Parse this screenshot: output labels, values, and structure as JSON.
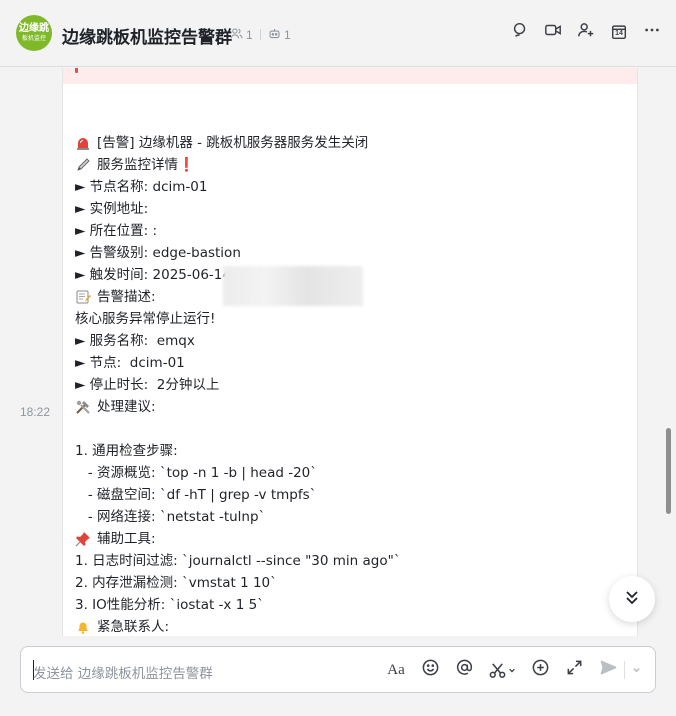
{
  "header": {
    "avatar_line1": "边缘跳",
    "avatar_line2": "板机监控",
    "title": "边缘跳板机监控告警群",
    "members_count": "1",
    "bots_count": "1",
    "icons": [
      "search-icon",
      "video-icon",
      "add-member-icon",
      "calendar-icon",
      "more-icon"
    ],
    "calendar_day": "14"
  },
  "message": {
    "time": "18:22",
    "lines": [
      {
        "emoji": "siren",
        "text": "[告警] 边缘机器 - 跳板机服务器服务发生关闭"
      },
      {
        "emoji": "pencil",
        "text": "服务监控详情❗"
      },
      {
        "emoji": null,
        "text": "► 节点名称: dcim-01"
      },
      {
        "emoji": null,
        "text": "► 实例地址: "
      },
      {
        "emoji": null,
        "text": "► 所在位置: :"
      },
      {
        "emoji": null,
        "text": "► 告警级别: edge-bastion"
      },
      {
        "emoji": null,
        "text": "► 触发时间: 2025-06-14 18:22:12"
      },
      {
        "emoji": "memo",
        "text": "告警描述:"
      },
      {
        "emoji": null,
        "text": "核心服务异常停止运行!"
      },
      {
        "emoji": null,
        "text": "► 服务名称:  emqx"
      },
      {
        "emoji": null,
        "text": "► 节点:  dcim-01"
      },
      {
        "emoji": null,
        "text": "► 停止时长:  2分钟以上"
      },
      {
        "emoji": "tools",
        "text": "处理建议:"
      },
      {
        "emoji": null,
        "text": ""
      },
      {
        "emoji": null,
        "text": "1. 通用检查步骤:"
      },
      {
        "emoji": null,
        "text": "   - 资源概览: `top -n 1 -b | head -20`"
      },
      {
        "emoji": null,
        "text": "   - 磁盘空间: `df -hT | grep -v tmpfs`"
      },
      {
        "emoji": null,
        "text": "   - 网络连接: `netstat -tulnp`"
      },
      {
        "emoji": "pushpin",
        "text": "辅助工具:"
      },
      {
        "emoji": null,
        "text": "1. 日志时间过滤: `journalctl --since \"30 min ago\"`"
      },
      {
        "emoji": null,
        "text": "2. 内存泄漏检测: `vmstat 1 10`"
      },
      {
        "emoji": null,
        "text": "3. IO性能分析: `iostat -x 1 5`"
      },
      {
        "emoji": "bell",
        "text": "紧急联系人:"
      }
    ]
  },
  "composer": {
    "placeholder": "发送给 边缘跳板机监控告警群",
    "format_label": "Aa",
    "tools": [
      "emoji-icon",
      "mention-icon",
      "scissors-icon",
      "plus-circle-icon",
      "expand-icon",
      "send-icon",
      "chevron-down-icon"
    ]
  },
  "colors": {
    "avatar": "#7fb92a",
    "card_header": "#fdeceb",
    "background": "#f3f3f3"
  }
}
